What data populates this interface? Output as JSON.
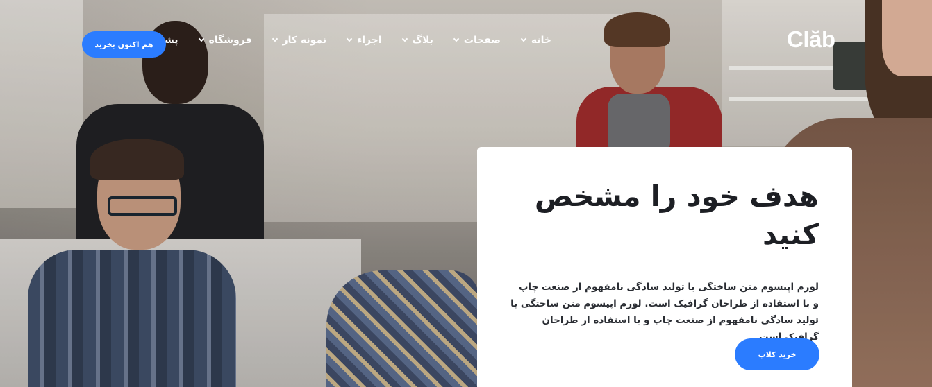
{
  "brand": {
    "logo_text": "Clăb"
  },
  "nav": {
    "items": [
      {
        "label": "خانه",
        "has_dropdown": true
      },
      {
        "label": "صفحات",
        "has_dropdown": true
      },
      {
        "label": "بلاگ",
        "has_dropdown": true
      },
      {
        "label": "اجزاء",
        "has_dropdown": true
      },
      {
        "label": "نمونه کار",
        "has_dropdown": true
      },
      {
        "label": "فروشگاه",
        "has_dropdown": true
      },
      {
        "label": "پشتیبانی",
        "has_dropdown": true
      }
    ],
    "cta_label": "هم اکنون بخرید"
  },
  "hero": {
    "title": "هدف خود را مشخص کنید",
    "text": "لورم اپیسوم متن ساختگی با تولید سادگی نامفهوم از صنعت چاپ و با استفاده از طراحان گرافیک است. لورم اپیسوم متن ساختگی با تولید سادگی نامفهوم از صنعت چاپ و با استفاده از طراحان گرافیک است.",
    "button_label": "خرید کلاب"
  },
  "colors": {
    "accent": "#2b7cff",
    "card_bg": "#ffffff",
    "title_text": "#1d1f24",
    "nav_text": "#ffffff"
  }
}
